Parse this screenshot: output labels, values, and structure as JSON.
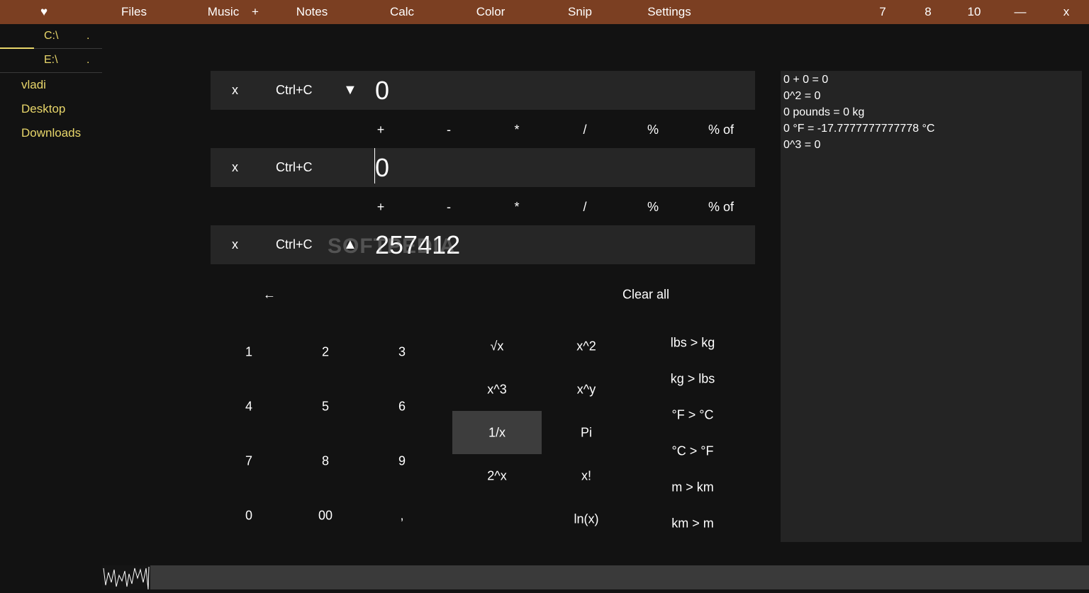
{
  "topbar": {
    "heart_icon": "heart-icon",
    "menu": [
      "Files",
      "Music",
      "+",
      "Notes",
      "Calc",
      "Color",
      "Snip",
      "Settings"
    ],
    "right": [
      "7",
      "8",
      "10",
      "—",
      "x"
    ]
  },
  "sidebar": {
    "drives": [
      {
        "label": "C:\\",
        "dot": "."
      },
      {
        "label": "E:\\",
        "dot": "."
      }
    ],
    "folders": [
      "vladi",
      "Desktop",
      "Downloads"
    ]
  },
  "calc": {
    "inputs": [
      {
        "clear": "x",
        "copy": "Ctrl+C",
        "arrow": "▼",
        "value": "0"
      },
      {
        "clear": "x",
        "copy": "Ctrl+C",
        "arrow": "",
        "value": "0"
      },
      {
        "clear": "x",
        "copy": "Ctrl+C",
        "arrow": "▲",
        "value": "257412"
      }
    ],
    "operators": [
      "+",
      "-",
      "*",
      "/",
      "%",
      "% of"
    ],
    "backspace": "←",
    "clear_all": "Clear all",
    "digits": [
      "1",
      "2",
      "3",
      "4",
      "5",
      "6",
      "7",
      "8",
      "9",
      "0",
      "00",
      ","
    ],
    "functions_a": [
      "√x",
      "x^3",
      "1/x",
      "2^x"
    ],
    "functions_b": [
      "x^2",
      "x^y",
      "Pi",
      "x!",
      "ln(x)"
    ],
    "conversions": [
      "lbs > kg",
      "kg > lbs",
      "°F > °C",
      "°C > °F",
      "m > km",
      "km > m"
    ]
  },
  "history": [
    "0 + 0 = 0",
    "0^2 = 0",
    "0 pounds = 0 kg",
    "0 °F = -17.7777777777778 °C",
    "0^3 = 0"
  ],
  "watermark": "SOFTPEDIA"
}
